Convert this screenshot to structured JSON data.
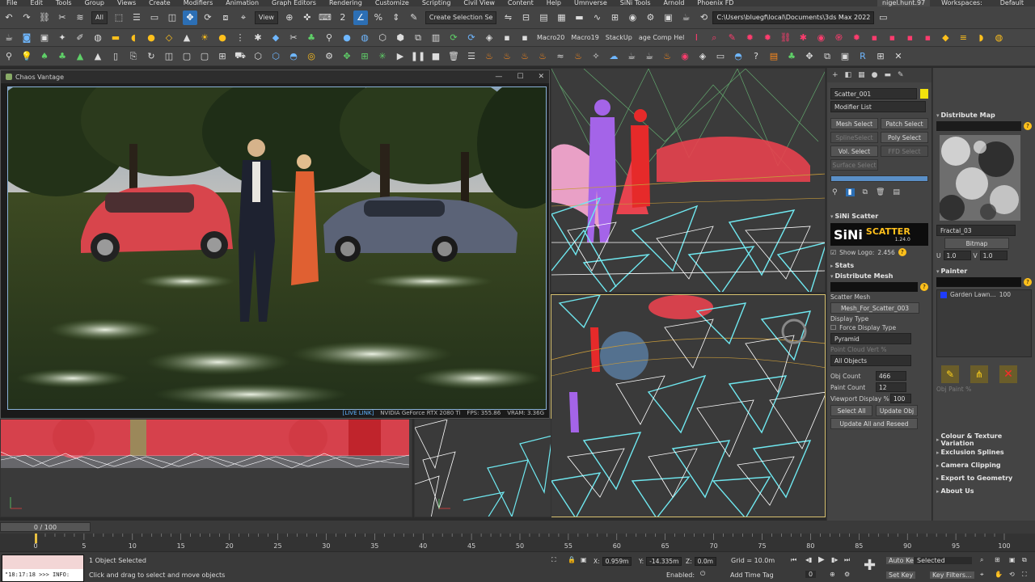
{
  "menu": {
    "items": [
      "File",
      "Edit",
      "Tools",
      "Group",
      "Views",
      "Create",
      "Modifiers",
      "Animation",
      "Graph Editors",
      "Rendering",
      "Customize",
      "Scripting",
      "Civil View",
      "Content",
      "Help",
      "Umnverse",
      "SiNi Tools",
      "Arnold",
      "Phoenix FD"
    ],
    "user": "nigel.hunt.97",
    "workspaces_label": "Workspaces:",
    "workspace_value": "Default"
  },
  "toolbar1": {
    "filter_dropdown": "All",
    "view_dropdown": "View",
    "selection_set_dropdown": "Create Selection Se",
    "path": "C:\\Users\\bluegf\\local\\Documents\\3ds Max 2022"
  },
  "toolbar2": {
    "labels": [
      "Macro20",
      "Macro19",
      "StackUp",
      "age Comp Hel"
    ]
  },
  "vantage": {
    "title": "Chaos Vantage",
    "status_live": "[LIVE LINK]",
    "status_gpu": "NVIDIA GeForce RTX 2080 Ti",
    "status_fps": "FPS: 355.86",
    "status_vram": "VRAM: 3.36G"
  },
  "command_panel": {
    "object_name": "Scatter_001",
    "object_color": "#f2e20d",
    "modifier_list": "Modifier List",
    "buttons": {
      "mesh_select": "Mesh Select",
      "patch_select": "Patch Select",
      "spline_select": "SplineSelect",
      "poly_select": "Poly Select",
      "vol_select": "Vol. Select",
      "ffd_select": "FFD Select",
      "surface_select": "Surface Select"
    },
    "sini_scatter": {
      "header": "SiNi Scatter",
      "logo_sini": "SiNi",
      "logo_software": "Software",
      "logo_scatter": "SCATTER",
      "version": "1.24.0",
      "show_logo_label": "Show Logo:",
      "show_logo_value": "2.456"
    },
    "stats": "Stats",
    "distribute_mesh": {
      "header": "Distribute Mesh",
      "scatter_mesh_label": "Scatter Mesh",
      "scatter_mesh_value": "Mesh_For_Scatter_003",
      "display_type_label": "Display Type",
      "force_display_type": "Force Display Type",
      "display_type_value": "Pyramid",
      "point_cloud_label": "Point Cloud Vert %",
      "objects_value": "All Objects",
      "obj_count_label": "Obj Count",
      "obj_count_value": "466",
      "paint_count_label": "Paint Count",
      "paint_count_value": "12",
      "viewport_display_label": "Viewport Display %",
      "viewport_display_value": "100",
      "select_all": "Select All",
      "update_obj": "Update Obj",
      "update_all": "Update All and Reseed"
    }
  },
  "right_panel": {
    "distribute_map": "Distribute Map",
    "map_name": "Fractal_03",
    "map_type": "Bitmap",
    "u_label": "U",
    "u_value": "1.0",
    "v_label": "V",
    "v_value": "1.0",
    "painter": "Painter",
    "painter_item_name": "Garden Lawn...",
    "painter_item_value": "100",
    "painter_item_color": "#1f3cff",
    "obj_paint_label": "Obj Paint %",
    "sections": [
      "Colour & Texture Variation",
      "Exclusion Splines",
      "Camera Clipping",
      "Export to Geometry",
      "About Us"
    ]
  },
  "timeline": {
    "slider": "0 / 100",
    "ticks": [
      "0",
      "5",
      "10",
      "15",
      "20",
      "25",
      "30",
      "35",
      "40",
      "45",
      "50",
      "55",
      "60",
      "65",
      "70",
      "75",
      "80",
      "85",
      "90",
      "95",
      "100"
    ]
  },
  "status": {
    "selection": "1 Object Selected",
    "hint": "Click and drag to select and move objects",
    "script_output": "\"18:17:18 >>> INFO:",
    "x_label": "X:",
    "x_value": "0.959m",
    "y_label": "Y:",
    "y_value": "-14.335m",
    "z_label": "Z:",
    "z_value": "0.0m",
    "grid": "Grid = 10.0m",
    "enabled": "Enabled:",
    "add_time_tag": "Add Time Tag",
    "frame_value": "0",
    "auto_key": "Auto Key",
    "set_key": "Set Key",
    "key_mode": "Selected",
    "key_filters": "Key Filters..."
  },
  "colors": {
    "accent_blue": "#2c6fb5",
    "wire_cyan": "#6fe8f0",
    "scatter_red": "#e8434f"
  }
}
